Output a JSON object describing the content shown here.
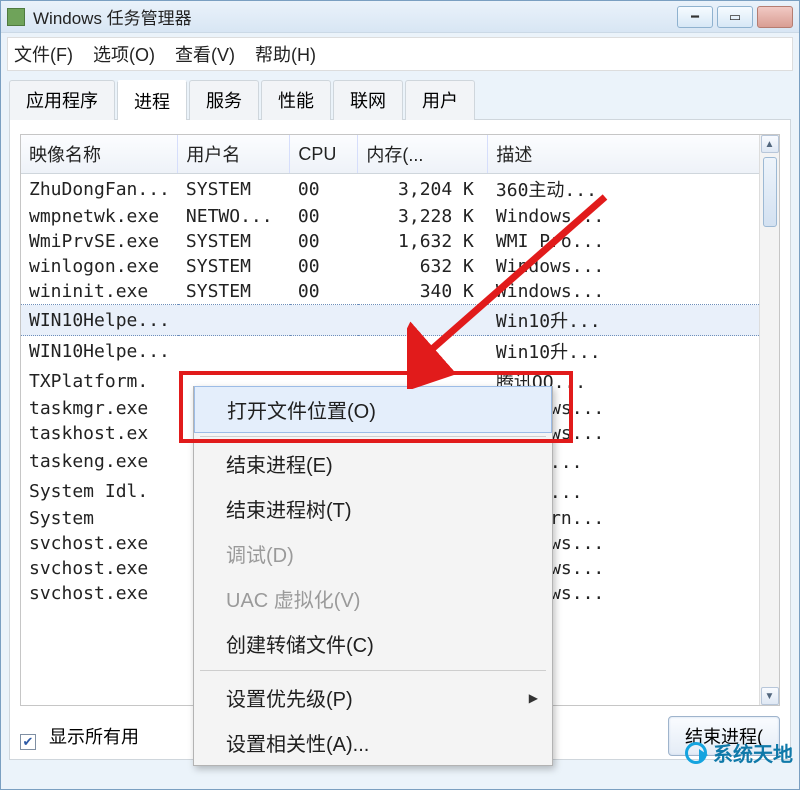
{
  "window": {
    "title": "Windows 任务管理器"
  },
  "menu": {
    "file": "文件(F)",
    "options": "选项(O)",
    "view": "查看(V)",
    "help": "帮助(H)"
  },
  "tabs": {
    "apps": "应用程序",
    "processes": "进程",
    "services": "服务",
    "performance": "性能",
    "networking": "联网",
    "users": "用户"
  },
  "columns": {
    "image": "映像名称",
    "user": "用户名",
    "cpu": "CPU",
    "memory": "内存(...",
    "desc": "描述"
  },
  "rows": [
    {
      "image": "ZhuDongFan...",
      "user": "SYSTEM",
      "cpu": "00",
      "mem": "3,204 K",
      "desc": "360主动..."
    },
    {
      "image": "wmpnetwk.exe",
      "user": "NETWO...",
      "cpu": "00",
      "mem": "3,228 K",
      "desc": "Windows..."
    },
    {
      "image": "WmiPrvSE.exe",
      "user": "SYSTEM",
      "cpu": "00",
      "mem": "1,632 K",
      "desc": "WMI Pro..."
    },
    {
      "image": "winlogon.exe",
      "user": "SYSTEM",
      "cpu": "00",
      "mem": "632 K",
      "desc": "Windows..."
    },
    {
      "image": "wininit.exe",
      "user": "SYSTEM",
      "cpu": "00",
      "mem": "340 K",
      "desc": "Windows..."
    },
    {
      "image": "WIN10Helpe...",
      "user": "",
      "cpu": "",
      "mem": "",
      "desc": "Win10升..."
    },
    {
      "image": "WIN10Helpe...",
      "user": "",
      "cpu": "",
      "mem": "",
      "desc": "Win10升..."
    },
    {
      "image": "TXPlatform.",
      "user": "",
      "cpu": "",
      "mem": "",
      "desc": "腾讯QQ..."
    },
    {
      "image": "taskmgr.exe",
      "user": "",
      "cpu": "",
      "mem": "",
      "desc": "Windows..."
    },
    {
      "image": "taskhost.ex",
      "user": "",
      "cpu": "",
      "mem": "",
      "desc": "Windows..."
    },
    {
      "image": "taskeng.exe",
      "user": "",
      "cpu": "",
      "mem": "",
      "desc": "任务计..."
    },
    {
      "image": "System Idl.",
      "user": "",
      "cpu": "",
      "mem": "",
      "desc": "处理器..."
    },
    {
      "image": "System",
      "user": "",
      "cpu": "",
      "mem": "",
      "desc": "NT Kern..."
    },
    {
      "image": "svchost.exe",
      "user": "",
      "cpu": "",
      "mem": "",
      "desc": "Windows..."
    },
    {
      "image": "svchost.exe",
      "user": "",
      "cpu": "",
      "mem": "",
      "desc": "Windows..."
    },
    {
      "image": "svchost.exe",
      "user": "",
      "cpu": "",
      "mem": "",
      "desc": "Windows..."
    }
  ],
  "context_menu": {
    "open_location": "打开文件位置(O)",
    "end_process": "结束进程(E)",
    "end_tree": "结束进程树(T)",
    "debug": "调试(D)",
    "uac": "UAC 虚拟化(V)",
    "create_dump": "创建转储文件(C)",
    "set_priority": "设置优先级(P)",
    "set_affinity": "设置相关性(A)..."
  },
  "bottom": {
    "show_all_label": "显示所有用",
    "end_button": "结束进程("
  },
  "brand": {
    "text": "系统天地"
  }
}
